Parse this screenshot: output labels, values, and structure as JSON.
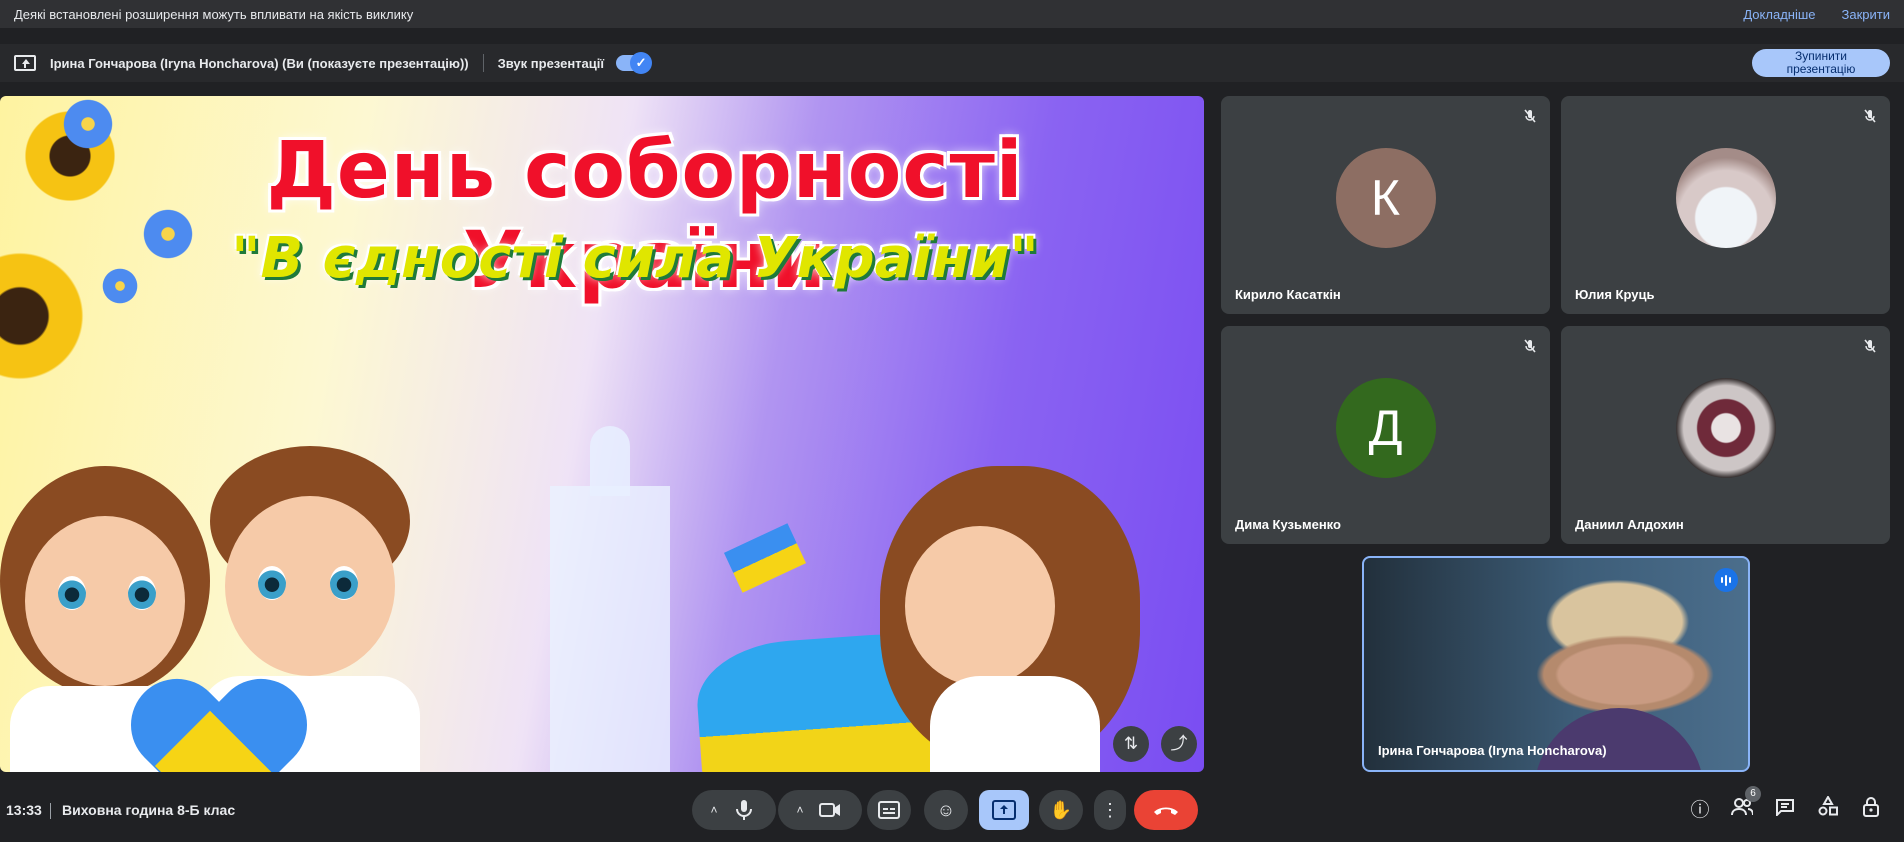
{
  "notice": {
    "text": "Деякі встановлені розширення можуть впливати на якість виклику",
    "learn_more": "Докладніше",
    "close": "Закрити"
  },
  "presentation_bar": {
    "presenter": "Ірина Гончарова (Iryna Honcharova) (Ви (показуєте презентацію))",
    "sound_label": "Звук презентації",
    "sound_enabled": true,
    "stop_button": "Зупинити презентацію"
  },
  "slide": {
    "title": "День соборності України",
    "subtitle": "\"В єдності сила України\""
  },
  "participants": [
    {
      "name": "Кирило Касаткін",
      "initial": "К",
      "avatar_color": "#8d6e63",
      "muted": true
    },
    {
      "name": "Юлия Круць",
      "initial": "",
      "avatar_color": "",
      "muted": true
    },
    {
      "name": "Дима Кузьменко",
      "initial": "Д",
      "avatar_color": "#33691e",
      "muted": true
    },
    {
      "name": "Даниил Алдохин",
      "initial": "",
      "avatar_color": "",
      "muted": true
    }
  ],
  "self_view": {
    "name": "Ірина Гончарова (Iryna Honcharova)"
  },
  "bottom_bar": {
    "time": "13:33",
    "meeting_title": "Виховна година 8-Б клас",
    "people_count": "6"
  },
  "colors": {
    "accent": "#8ab4f8",
    "present_btn": "#a8c7fa",
    "leave_btn": "#ea4335",
    "bg": "#202124",
    "tile": "#3c4043"
  }
}
